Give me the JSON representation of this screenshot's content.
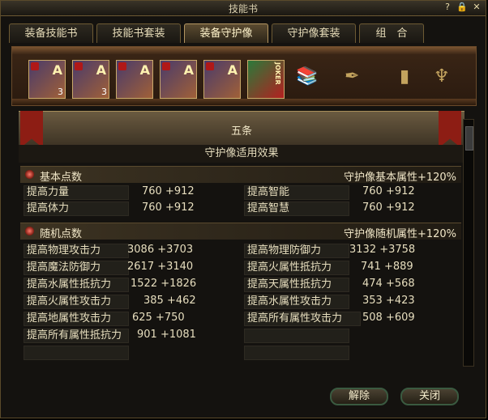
{
  "window": {
    "title": "技能书"
  },
  "titlebar_icons": [
    {
      "name": "help-icon",
      "glyph": "?"
    },
    {
      "name": "lock-icon",
      "glyph": "🔒"
    },
    {
      "name": "close-icon",
      "glyph": "✕"
    }
  ],
  "tabs": [
    {
      "label": "装备技能书"
    },
    {
      "label": "技能书套装"
    },
    {
      "label": "装备守护像"
    },
    {
      "label": "守护像套装"
    },
    {
      "label": "组　合"
    }
  ],
  "cards": [
    {
      "letter": "A",
      "count": "3"
    },
    {
      "letter": "A",
      "count": "3"
    },
    {
      "letter": "A",
      "count": ""
    },
    {
      "letter": "A",
      "count": ""
    },
    {
      "letter": "A",
      "count": ""
    },
    {
      "letter": "JOKER",
      "count": ""
    }
  ],
  "banner": {
    "name": "五条"
  },
  "subtitle": "守护像适用效果",
  "basic": {
    "label": "基本点数",
    "bonus": "守护像基本属性+120%",
    "rows": [
      {
        "l_label": "提高力量",
        "l_val": "760 +912",
        "r_label": "提高智能",
        "r_val": "760 +912"
      },
      {
        "l_label": "提高体力",
        "l_val": "760 +912",
        "r_label": "提高智慧",
        "r_val": "760 +912"
      }
    ]
  },
  "random": {
    "label": "随机点数",
    "bonus": "守护像随机属性+120%",
    "rows": [
      {
        "l_label": "提高物理攻击力",
        "l_val": "3086 +3703",
        "r_label": "提高物理防御力",
        "r_val": "3132 +3758"
      },
      {
        "l_label": "提高魔法防御力",
        "l_val": "2617 +3140",
        "r_label": "提高火属性抵抗力",
        "r_val": "741 +889"
      },
      {
        "l_label": "提高水属性抵抗力",
        "l_val": "1522 +1826",
        "r_label": "提高天属性抵抗力",
        "r_val": "474 +568"
      },
      {
        "l_label": "提高火属性攻击力",
        "l_val": "385 +462",
        "r_label": "提高水属性攻击力",
        "r_val": "353 +423"
      },
      {
        "l_label": "提高地属性攻击力",
        "l_val": "625 +750",
        "r_label": "提高所有属性攻击力",
        "r_val": "508 +609"
      },
      {
        "l_label": "提高所有属性抵抗力",
        "l_val": "901 +1081",
        "r_label": "",
        "r_val": ""
      },
      {
        "l_label": "",
        "l_val": "",
        "r_label": "",
        "r_val": ""
      }
    ]
  },
  "buttons": {
    "unequip": "解除",
    "close": "关闭"
  }
}
